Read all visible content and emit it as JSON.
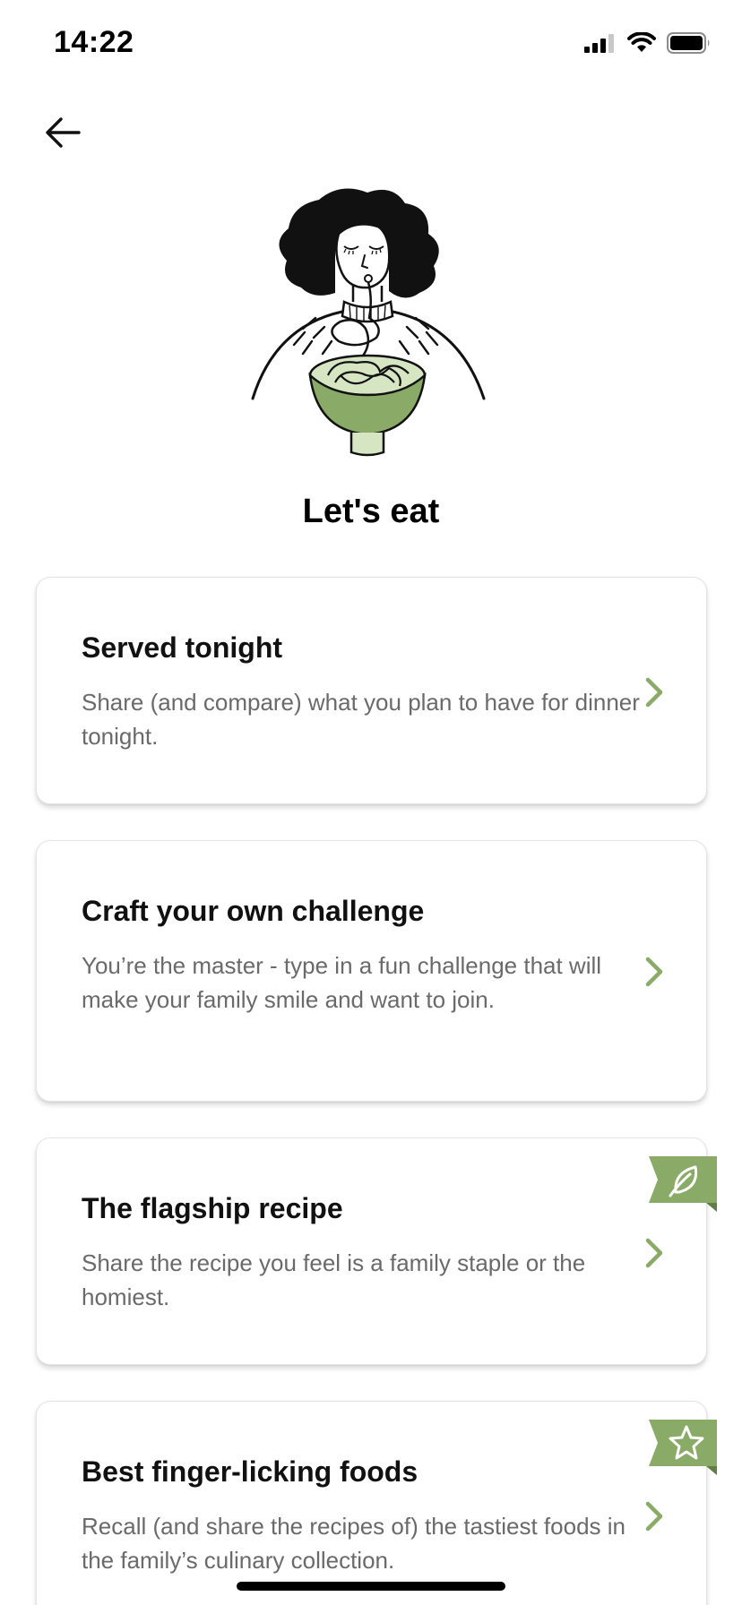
{
  "status_bar": {
    "time": "14:22",
    "icons": [
      "cellular-signal-icon",
      "wifi-icon",
      "battery-icon"
    ]
  },
  "header": {
    "back_icon": "arrow-left-icon",
    "hero_illustration": "woman-eating-noodles-illustration",
    "title": "Let's eat"
  },
  "colors": {
    "accent_green": "#8aab67",
    "accent_green_dark": "#5f7f44",
    "bowl_light": "#d6e6c3",
    "text_primary": "#111111",
    "text_secondary": "#6a6a6a"
  },
  "cards": [
    {
      "title": "Served tonight",
      "description": "Share (and compare) what you plan to have for dinner tonight.",
      "badge": null
    },
    {
      "title": "Craft your own challenge",
      "description": "You’re the master - type in a fun challenge that will make your family smile and want to join.",
      "badge": null
    },
    {
      "title": "The flagship recipe",
      "description": "Share the recipe you feel is a family staple or the homiest.",
      "badge": "leaf-icon"
    },
    {
      "title": "Best finger-licking foods",
      "description": "Recall (and share the recipes of) the tastiest foods in the family’s culinary collection.",
      "badge": "star-icon"
    }
  ]
}
